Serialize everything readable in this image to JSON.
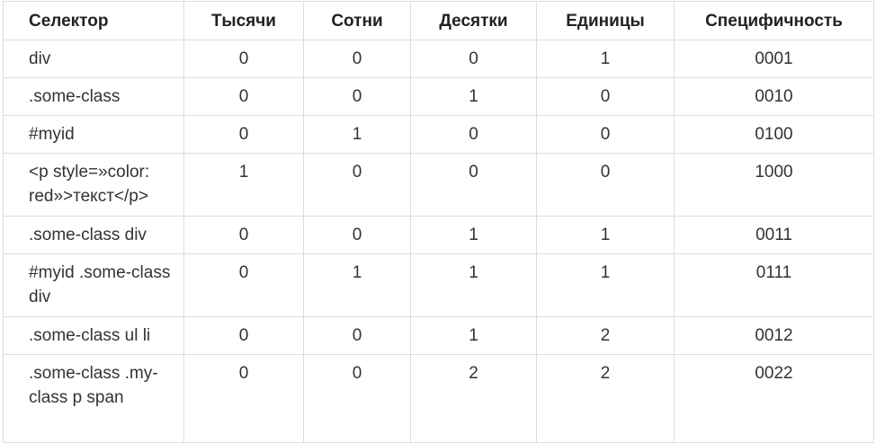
{
  "table": {
    "headers": [
      "Селектор",
      "Тысячи",
      "Сотни",
      "Десятки",
      "Единицы",
      "Специфичность"
    ],
    "rows": [
      {
        "selector": "div",
        "thousands": "0",
        "hundreds": "0",
        "tens": "0",
        "units": "1",
        "specificity": "0001"
      },
      {
        "selector": ".some-class",
        "thousands": "0",
        "hundreds": "0",
        "tens": "1",
        "units": "0",
        "specificity": "0010"
      },
      {
        "selector": "#myid",
        "thousands": "0",
        "hundreds": "1",
        "tens": "0",
        "units": "0",
        "specificity": "0100"
      },
      {
        "selector": "<p style=»color: red»>текст</p>",
        "thousands": "1",
        "hundreds": "0",
        "tens": "0",
        "units": "0",
        "specificity": "1000"
      },
      {
        "selector": ".some-class div",
        "thousands": "0",
        "hundreds": "0",
        "tens": "1",
        "units": "1",
        "specificity": "0011"
      },
      {
        "selector": "#myid .some-class div",
        "thousands": "0",
        "hundreds": "1",
        "tens": "1",
        "units": "1",
        "specificity": "0111"
      },
      {
        "selector": ".some-class ul li",
        "thousands": "0",
        "hundreds": "0",
        "tens": "1",
        "units": "2",
        "specificity": "0012"
      },
      {
        "selector": ".some-class .my-class p span",
        "thousands": "0",
        "hundreds": "0",
        "tens": "2",
        "units": "2",
        "specificity": "0022"
      }
    ]
  }
}
